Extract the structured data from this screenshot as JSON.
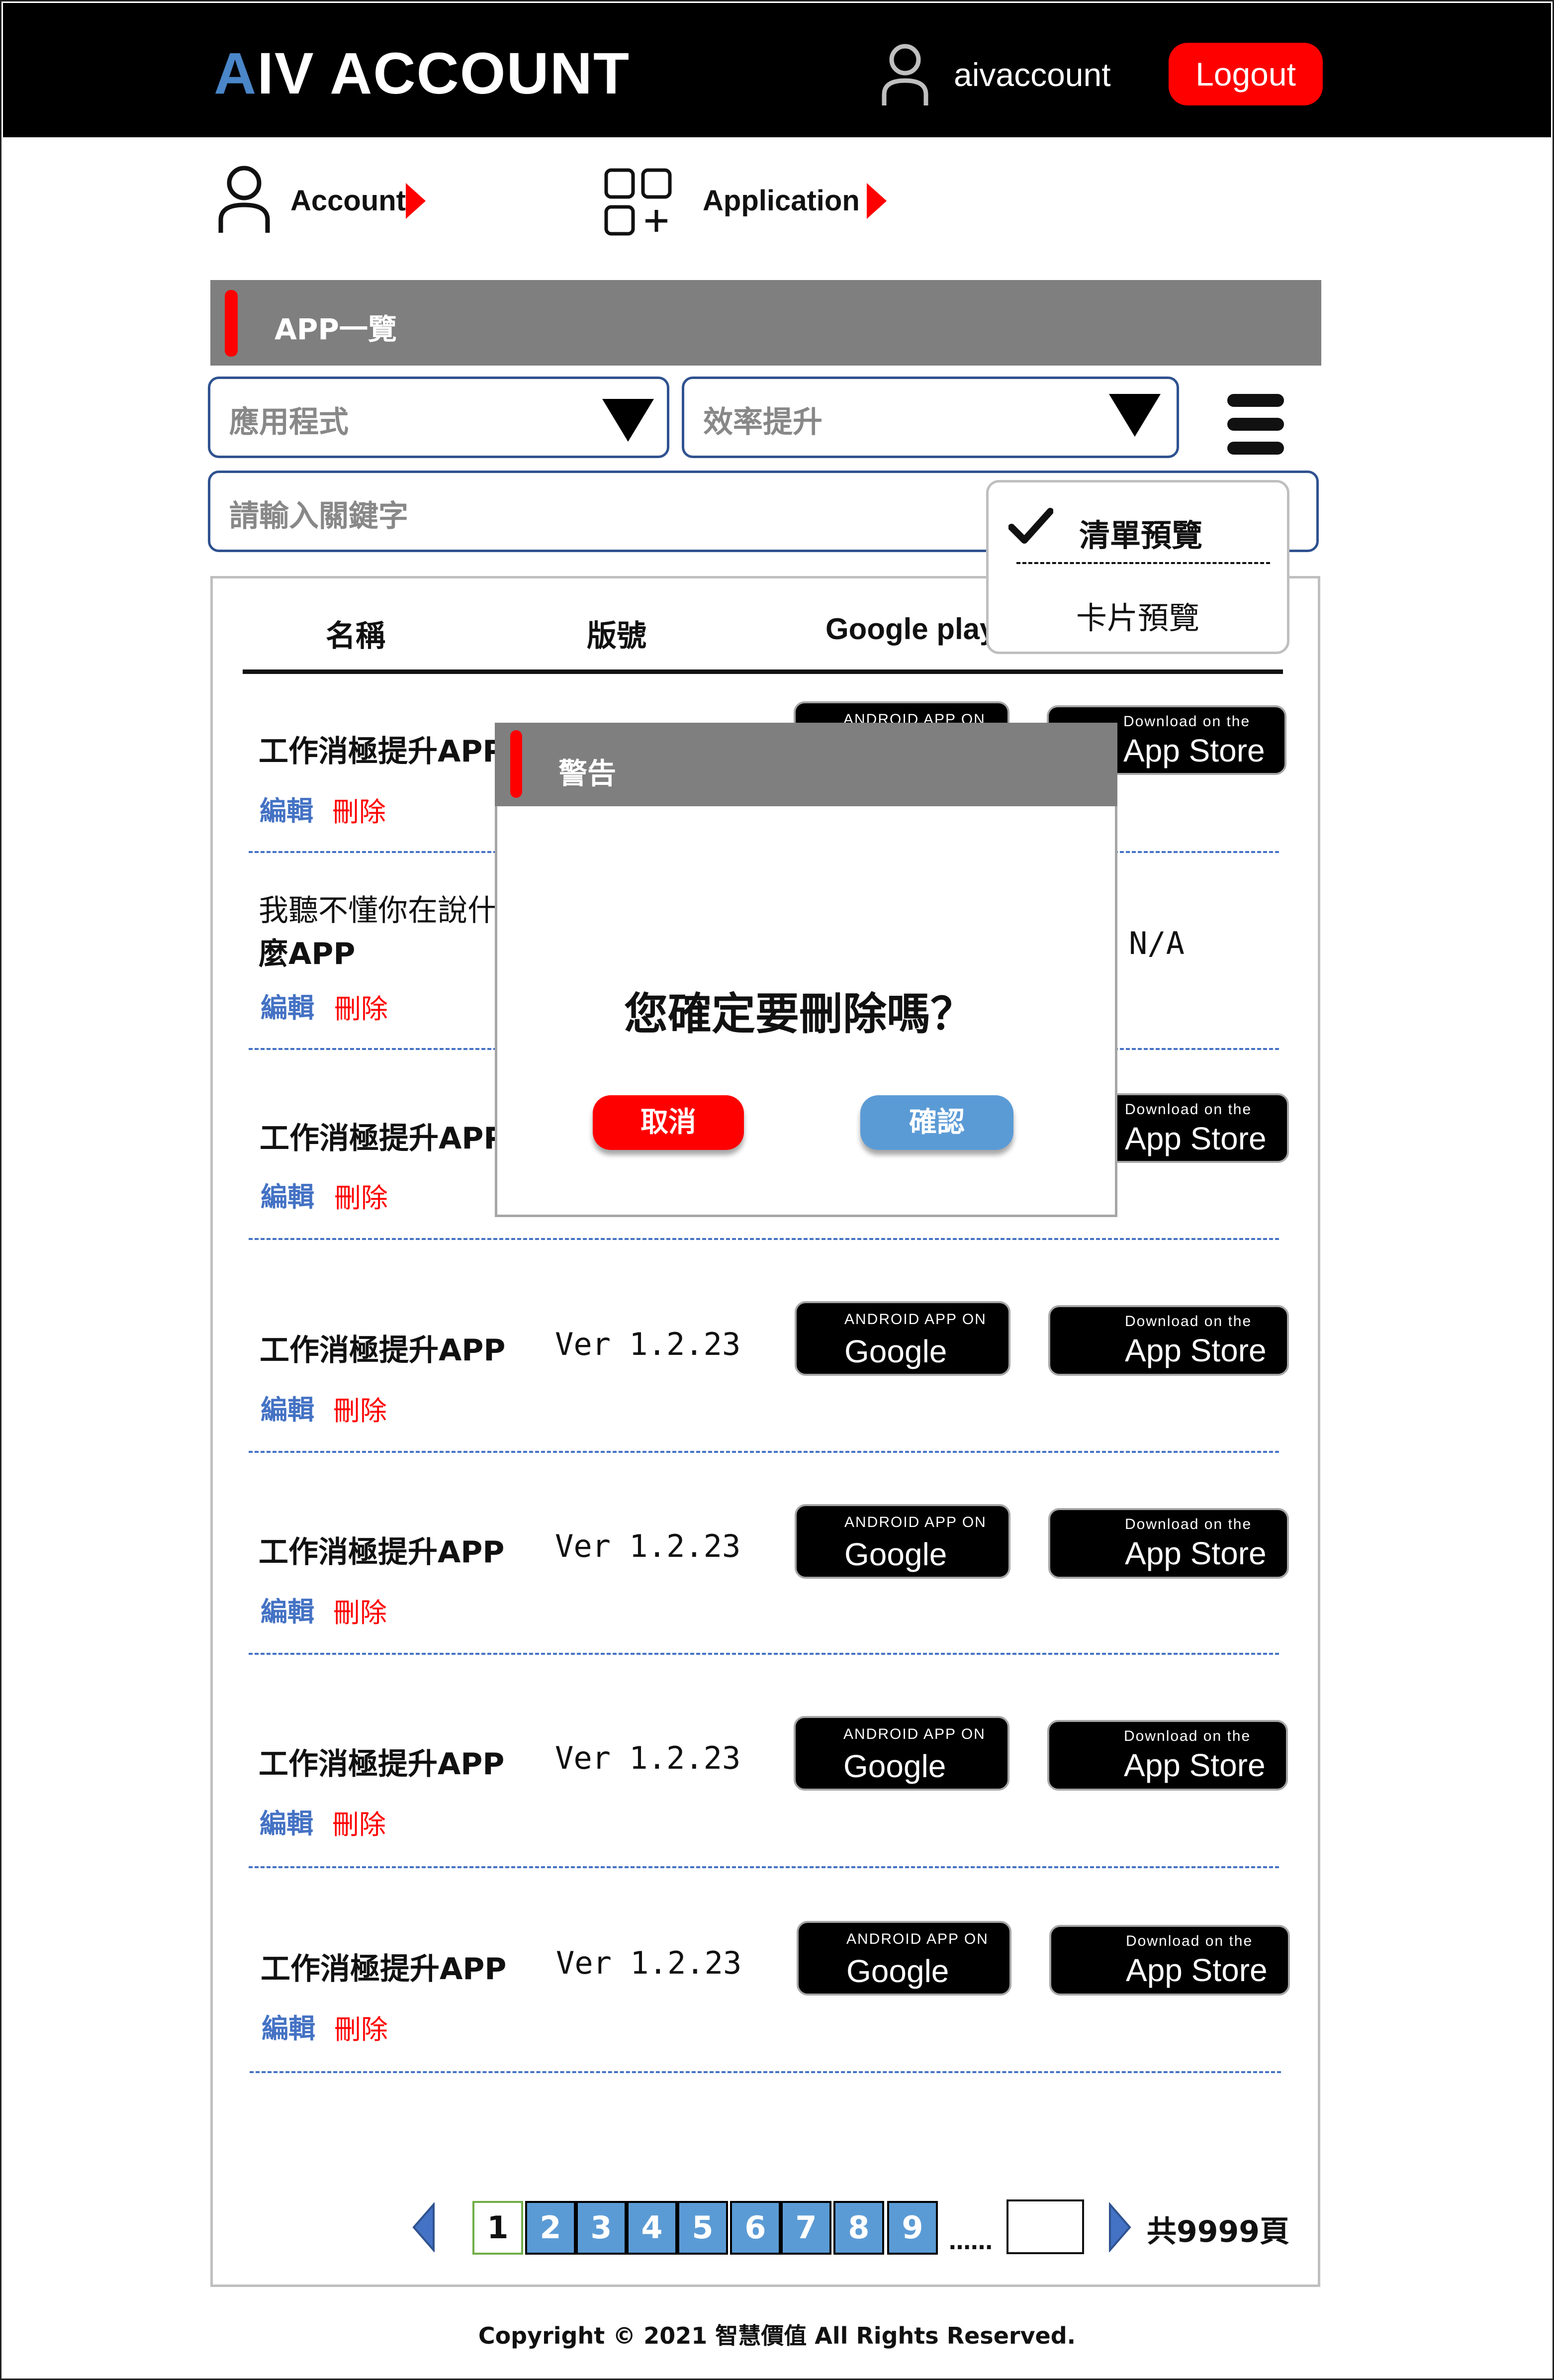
{
  "header": {
    "logo_prefix": "A",
    "logo_rest": "IV ACCOUNT",
    "username": "aivaccount",
    "logout_label": "Logout"
  },
  "nav": {
    "account_label": "Account",
    "application_label": "Application"
  },
  "section": {
    "title": "APP一覽"
  },
  "filters": {
    "category_value": "應用程式",
    "subcategory_value": "效率提升",
    "search_placeholder": "請輸入關鍵字"
  },
  "view_menu": {
    "list_view": "清單預覽",
    "card_view": "卡片預覽",
    "selected": "清單預覽"
  },
  "table": {
    "headers": {
      "name": "名稱",
      "version": "版號",
      "google": "Google play"
    },
    "edit_label": "編輯",
    "delete_label": "刪除",
    "rows": [
      {
        "name": "工作消極提升APP",
        "version": "",
        "google": "available",
        "apple": "available"
      },
      {
        "name": "我聽不懂你在說什",
        "name_line2": "麼APP",
        "version": "",
        "google": "",
        "apple": "N/A"
      },
      {
        "name": "工作消極提升APP",
        "version": "",
        "google": "",
        "apple": "available"
      },
      {
        "name": "工作消極提升APP",
        "version": "Ver 1.2.23",
        "google": "available",
        "apple": "available"
      },
      {
        "name": "工作消極提升APP",
        "version": "Ver 1.2.23",
        "google": "available",
        "apple": "available"
      },
      {
        "name": "工作消極提升APP",
        "version": "Ver 1.2.23",
        "google": "available",
        "apple": "available"
      },
      {
        "name": "工作消極提升APP",
        "version": "Ver 1.2.23",
        "google": "available",
        "apple": "available"
      }
    ]
  },
  "badges": {
    "google_small": "ANDROID APP ON",
    "google_big": "Google play",
    "apple_small": "Download on the",
    "apple_big": "App Store"
  },
  "dialog": {
    "title": "警告",
    "message": "您確定要刪除嗎？",
    "cancel_label": "取消",
    "confirm_label": "確認"
  },
  "pagination": {
    "pages": [
      "1",
      "2",
      "3",
      "4",
      "5",
      "6",
      "7",
      "8",
      "9"
    ],
    "current": "1",
    "ellipsis": "……",
    "total_label": "共9999頁"
  },
  "footer": {
    "copyright": "Copyright © 2021 智慧價值 All Rights Reserved."
  },
  "colors": {
    "accent_red": "#ff0000",
    "accent_blue": "#5b9bd5",
    "link_blue": "#4472c4",
    "header_gray": "#7f7f7f"
  }
}
